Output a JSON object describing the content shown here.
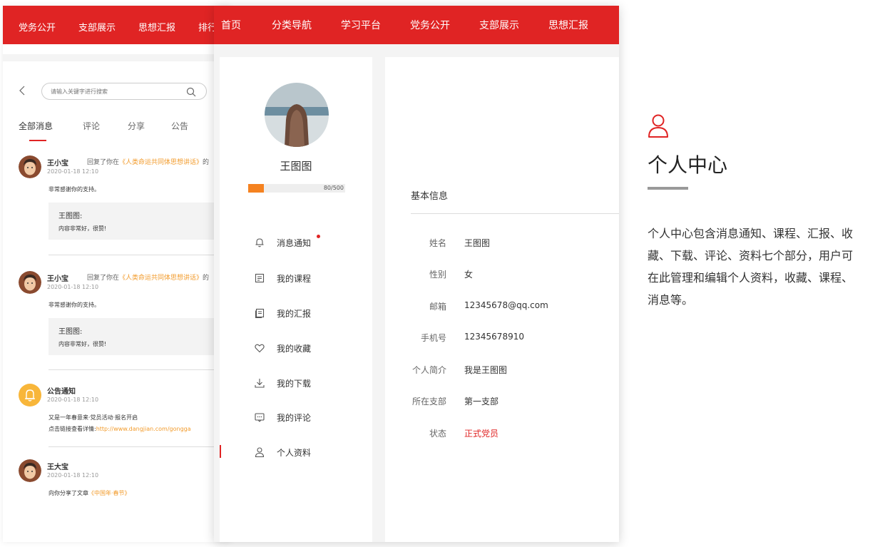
{
  "bg_nav": {
    "items": [
      "党务公开",
      "支部展示",
      "思想汇报",
      "排行"
    ]
  },
  "search": {
    "placeholder": "请输入关键字进行搜索"
  },
  "message_tabs": [
    "全部消息",
    "评论",
    "分享",
    "公告"
  ],
  "messages": [
    {
      "name": "王小宝",
      "action": "回复了你在",
      "link": "《人类命运共同体思想讲话》",
      "suffix": "的",
      "time": "2020-01-18 12:10",
      "text": "非常感谢你的支持。",
      "quote_name": "王图图:",
      "quote_text": "内容非常好，很赞!"
    },
    {
      "name": "王小宝",
      "action": "回复了你在",
      "link": "《人类命运共同体思想讲话》",
      "suffix": "的",
      "time": "2020-01-18 12:10",
      "text": "非常感谢你的支持。",
      "quote_name": "王图图:",
      "quote_text": "内容非常好，很赞!"
    }
  ],
  "notice": {
    "name": "公告通知",
    "time": "2020-01-18 12:10",
    "line1": "又是一年春意来·党员活动·报名开启",
    "line2_prefix": "点击链接查看详情:",
    "line2_link": "http://www.dangjian.com/gongga"
  },
  "share": {
    "name": "王大宝",
    "time": "2020-01-18 12:10",
    "text_prefix": "向你分享了文章",
    "text_link": "《中国年·春节》"
  },
  "main_nav": {
    "items": [
      "首页",
      "分类导航",
      "学习平台",
      "党务公开",
      "支部展示",
      "思想汇报"
    ]
  },
  "profile": {
    "name": "王图图",
    "progress_text": "80/500",
    "progress_value": 0.16
  },
  "menu": [
    {
      "label": "消息通知",
      "icon": "bell-icon",
      "dot": true
    },
    {
      "label": "我的课程",
      "icon": "course-icon"
    },
    {
      "label": "我的汇报",
      "icon": "report-icon"
    },
    {
      "label": "我的收藏",
      "icon": "heart-icon"
    },
    {
      "label": "我的下载",
      "icon": "download-icon"
    },
    {
      "label": "我的评论",
      "icon": "comment-icon"
    },
    {
      "label": "个人资料",
      "icon": "user-icon",
      "active": true
    }
  ],
  "basic_info": {
    "title": "基本信息",
    "rows": [
      {
        "label": "姓名",
        "value": "王图图"
      },
      {
        "label": "性别",
        "value": "女"
      },
      {
        "label": "邮箱",
        "value": "12345678@qq.com"
      },
      {
        "label": "手机号",
        "value": "12345678910"
      },
      {
        "label": "个人简介",
        "value": "我是王图图"
      },
      {
        "label": "所在支部",
        "value": "第一支部"
      },
      {
        "label": "状态",
        "value": "正式党员",
        "highlight": true
      }
    ]
  },
  "description": {
    "title": "个人中心",
    "body": "个人中心包含消息通知、课程、汇报、收藏、下载、评论、资料七个部分，用户可在此管理和编辑个人资料，收藏、课程、消息等。"
  },
  "colors": {
    "brand_red": "#e02424",
    "accent_orange": "#f29b2b",
    "progress_orange": "#f58220"
  }
}
